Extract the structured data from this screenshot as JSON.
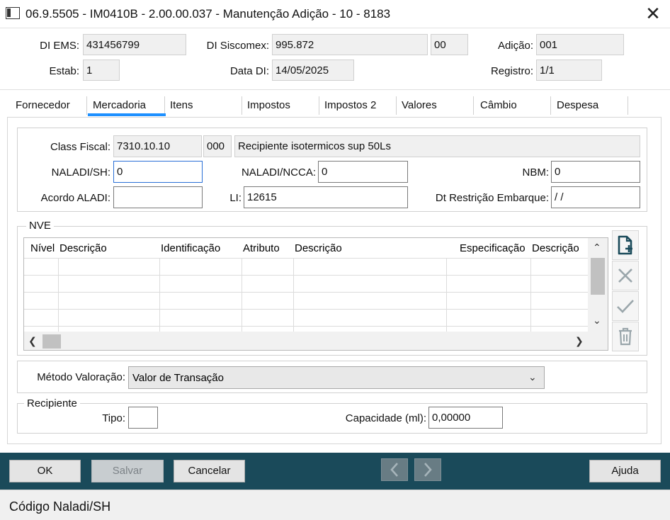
{
  "window": {
    "title": "06.9.5505 - IM0410B - 2.00.00.037 - Manutenção Adição - 10 - 8183",
    "close_glyph": "✕"
  },
  "header": {
    "di_ems_label": "DI EMS:",
    "di_ems_value": "431456799",
    "di_siscomex_label": "DI Siscomex:",
    "di_siscomex_value": "995.872",
    "di_siscomex_suffix": "00",
    "adicao_label": "Adição:",
    "adicao_value": "001",
    "estab_label": "Estab:",
    "estab_value": "1",
    "data_di_label": "Data DI:",
    "data_di_value": "14/05/2025",
    "registro_label": "Registro:",
    "registro_value": "1/1"
  },
  "tabs": [
    {
      "label": "Fornecedor"
    },
    {
      "label": "Mercadoria",
      "active": true
    },
    {
      "label": "Itens"
    },
    {
      "label": "Impostos"
    },
    {
      "label": "Impostos 2"
    },
    {
      "label": "Valores"
    },
    {
      "label": "Câmbio"
    },
    {
      "label": "Despesa"
    }
  ],
  "mercadoria": {
    "class_fiscal_label": "Class Fiscal:",
    "class_fiscal_value": "7310.10.10",
    "class_fiscal_code": "000",
    "class_fiscal_desc": "Recipiente isotermicos sup 50Ls",
    "naladi_sh_label": "NALADI/SH:",
    "naladi_sh_value": "0",
    "naladi_ncca_label": "NALADI/NCCA:",
    "naladi_ncca_value": "0",
    "nbm_label": "NBM:",
    "nbm_value": "0",
    "acordo_label": "Acordo ALADI:",
    "acordo_value": "",
    "li_label": "LI:",
    "li_value": "12615",
    "dt_restricao_label": "Dt Restrição Embarque:",
    "dt_restricao_value": " / /"
  },
  "nve": {
    "title": "NVE",
    "columns": [
      "Nível",
      "Descrição",
      "Identificação",
      "Atributo",
      "Descrição",
      "Especificação",
      "Descrição"
    ],
    "rows": [],
    "side_icons": [
      "new-document-icon",
      "delete-x-icon",
      "confirm-check-icon",
      "trash-icon"
    ]
  },
  "metodo": {
    "label": "Método Valoração:",
    "value": "Valor de Transação"
  },
  "recipiente": {
    "title": "Recipiente",
    "tipo_label": "Tipo:",
    "tipo_value": "",
    "capacidade_label": "Capacidade (ml):",
    "capacidade_value": "0,00000"
  },
  "buttons": {
    "ok": "OK",
    "salvar": "Salvar",
    "cancelar": "Cancelar",
    "ajuda": "Ajuda"
  },
  "status": {
    "text": "Código Naladi/SH"
  },
  "colors": {
    "accent": "#1e90ff",
    "bottom_bar": "#1a4a5a",
    "nve_icon": "#1a4a5a",
    "nve_icon_disabled": "#9aa6ab"
  }
}
